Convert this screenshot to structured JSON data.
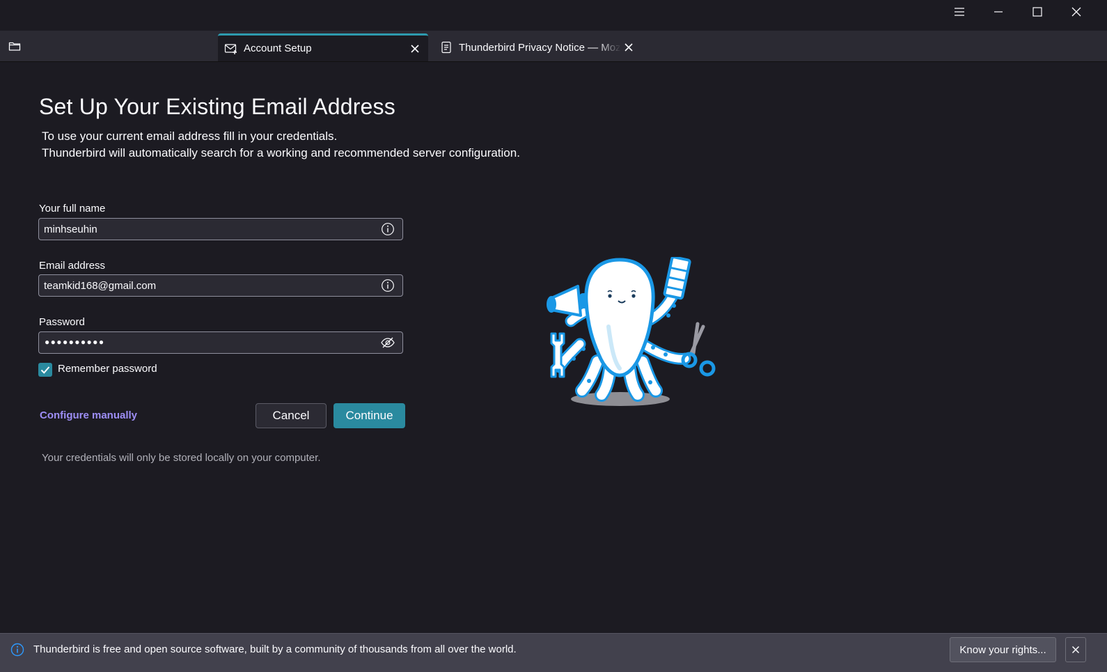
{
  "window": {
    "controls": [
      "menu-icon",
      "minimize-icon",
      "maximize-icon",
      "close-icon"
    ]
  },
  "tabs": [
    {
      "label": "Account Setup",
      "icon": "account-setup-icon",
      "active": true
    },
    {
      "label": "Thunderbird Privacy Notice — Mozilla",
      "icon": "document-icon",
      "active": false
    }
  ],
  "setup": {
    "title": "Set Up Your Existing Email Address",
    "description_line1": "To use your current email address fill in your credentials.",
    "description_line2": "Thunderbird will automatically search for a working and recommended server configuration.",
    "name_label": "Your full name",
    "name_value": "minhseuhin",
    "email_label": "Email address",
    "email_value": "teamkid168@gmail.com",
    "password_label": "Password",
    "password_mask": "●●●●●●●●●●",
    "remember_label": "Remember password",
    "remember_checked": true,
    "configure_manually": "Configure manually",
    "cancel_label": "Cancel",
    "continue_label": "Continue",
    "storage_note": "Your credentials will only be stored locally on your computer."
  },
  "notification": {
    "text": "Thunderbird is free and open source software, built by a community of thousands from all over the world.",
    "button_label": "Know your rights..."
  },
  "colors": {
    "accent": "#2a8a9f",
    "link": "#9d8ef5",
    "background": "#1c1b22",
    "mascot_blue": "#1a98e6"
  }
}
